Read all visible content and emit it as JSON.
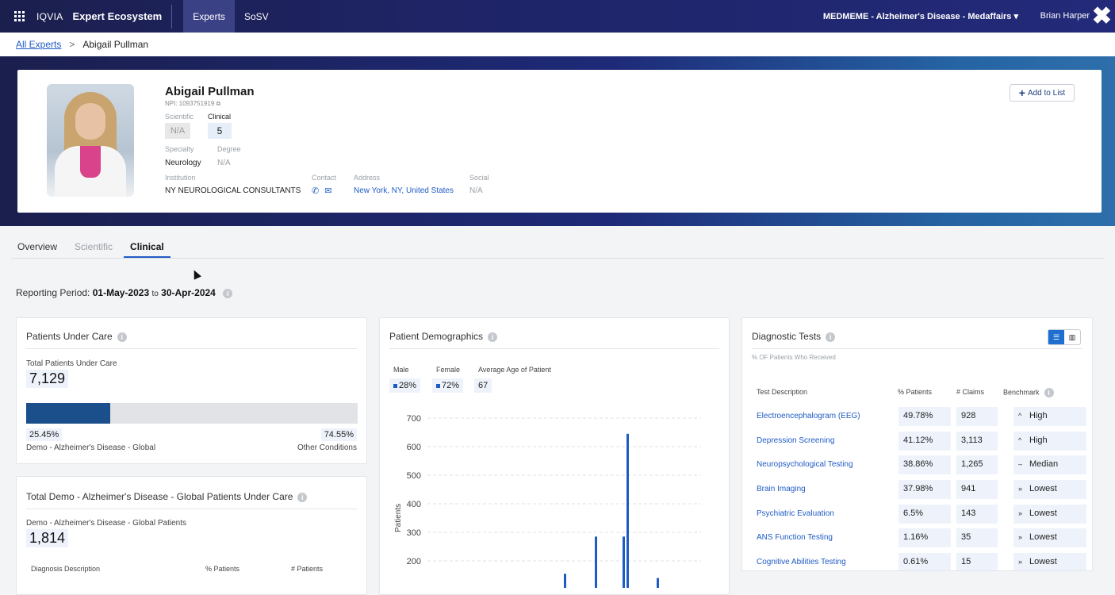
{
  "topbar": {
    "brand": "IQVIA",
    "app_name": "Expert Ecosystem",
    "nav": [
      "Experts",
      "SoSV"
    ],
    "project": "MEDMEME - Alzheimer's Disease - Medaffairs ▾",
    "user": "Brian Harper",
    "close_glyph": "✖"
  },
  "breadcrumb": {
    "root": "All Experts",
    "separator": ">",
    "current": "Abigail Pullman"
  },
  "profile": {
    "name": "Abigail Pullman",
    "npi": "NPI: 1093751919",
    "scientific_label": "Scientific",
    "scientific_value": "N/A",
    "clinical_label": "Clinical",
    "clinical_value": "5",
    "specialty_label": "Specialty",
    "specialty_value": "Neurology",
    "degree_label": "Degree",
    "degree_value": "N/A",
    "institution_label": "Institution",
    "institution_value": "NY NEUROLOGICAL CONSULTANTS",
    "contact_label": "Contact",
    "address_label": "Address",
    "address_value": "New York, NY, United States",
    "social_label": "Social",
    "social_value": "N/A",
    "add_to_list": "Add to List"
  },
  "tabs": [
    "Overview",
    "Scientific",
    "Clinical"
  ],
  "reporting_period": {
    "label": "Reporting Period:",
    "start": "01-May-2023",
    "to": "to",
    "end": "30-Apr-2024"
  },
  "patients_under_care": {
    "title": "Patients Under Care",
    "total_label": "Total Patients Under Care",
    "total_value": "7,129",
    "demo_pct": "25.45%",
    "other_pct": "74.55%",
    "demo_fraction": 0.2545,
    "demo_label": "Demo - Alzheimer's Disease - Global",
    "other_label": "Other Conditions"
  },
  "demo_global": {
    "title": "Total Demo - Alzheimer's Disease - Global Patients Under Care",
    "patients_label": "Demo - Alzheimer's Disease - Global Patients",
    "patients_value": "1,814",
    "col_diag": "Diagnosis Description",
    "col_pct": "% Patients",
    "col_num": "# Patients"
  },
  "demographics": {
    "title": "Patient Demographics",
    "male_label": "Male",
    "male_value": "28%",
    "female_label": "Female",
    "female_value": "72%",
    "age_label": "Average Age of Patient",
    "age_value": "67"
  },
  "chart_data": {
    "type": "bar",
    "ylabel": "Patients",
    "yticks": [
      200,
      300,
      400,
      500,
      600,
      700
    ],
    "ylim": [
      0,
      700
    ],
    "grid": true,
    "bars": [
      155,
      285,
      285,
      645,
      140
    ],
    "color": "#1f5bc5"
  },
  "diagnostic_tests": {
    "title": "Diagnostic Tests",
    "subtitle": "% OF Patients Who Received",
    "col_desc": "Test Description",
    "col_pct": "% Patients",
    "col_claims": "# Claims",
    "col_bench": "Benchmark",
    "rows": [
      {
        "name": "Electroencephalogram (EEG)",
        "pct": "49.78%",
        "claims": "928",
        "bench_icon": "^",
        "bench": "High"
      },
      {
        "name": "Depression Screening",
        "pct": "41.12%",
        "claims": "3,113",
        "bench_icon": "^",
        "bench": "High"
      },
      {
        "name": "Neuropsychological Testing",
        "pct": "38.86%",
        "claims": "1,265",
        "bench_icon": "–",
        "bench": "Median"
      },
      {
        "name": "Brain Imaging",
        "pct": "37.98%",
        "claims": "941",
        "bench_icon": "»",
        "bench": "Lowest"
      },
      {
        "name": "Psychiatric Evaluation",
        "pct": "6.5%",
        "claims": "143",
        "bench_icon": "»",
        "bench": "Lowest"
      },
      {
        "name": "ANS Function Testing",
        "pct": "1.16%",
        "claims": "35",
        "bench_icon": "»",
        "bench": "Lowest"
      },
      {
        "name": "Cognitive Abilities Testing",
        "pct": "0.61%",
        "claims": "15",
        "bench_icon": "»",
        "bench": "Lowest"
      }
    ]
  }
}
